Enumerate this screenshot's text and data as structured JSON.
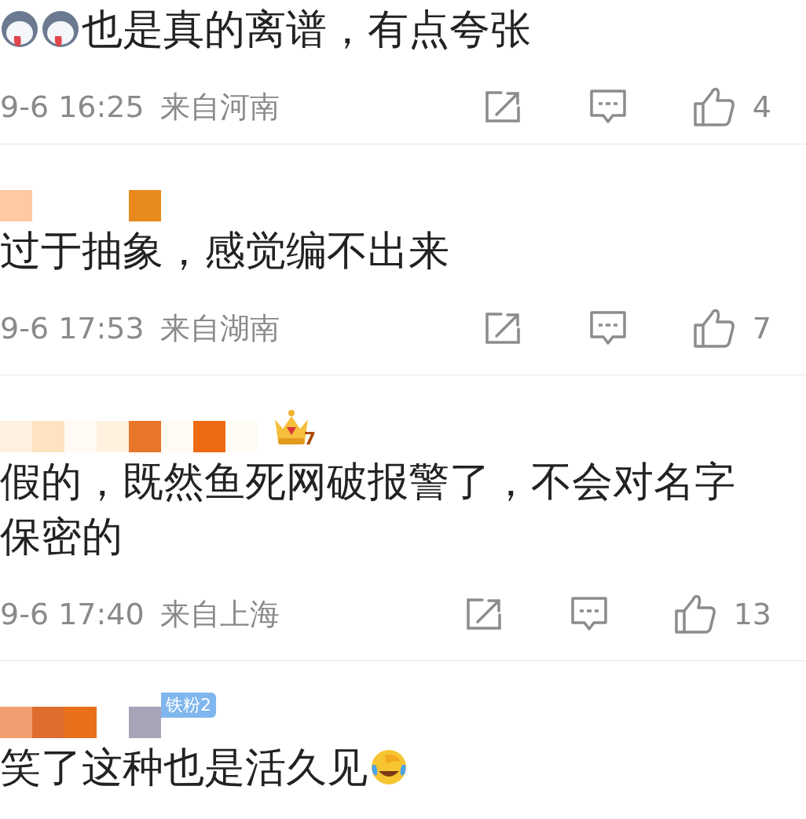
{
  "comments": [
    {
      "segments": [
        {
          "kind": "husky"
        },
        {
          "kind": "husky"
        },
        {
          "kind": "text",
          "text": "也是真的离谱，有点夸张"
        }
      ],
      "meta": {
        "time": "9-6 16:25",
        "location": "来自河南",
        "likes": "4"
      }
    },
    {
      "user": {
        "kind": "picture"
      },
      "segments": [
        {
          "kind": "text",
          "text": "过于抽象，感觉编不出来"
        }
      ],
      "meta": {
        "time": "9-6 17:53",
        "location": "来自湖南",
        "likes": "7"
      }
    },
    {
      "user": {
        "kind": "picture",
        "badge": {
          "kind": "crown",
          "label": "7"
        }
      },
      "segments": [
        {
          "kind": "text",
          "text": "假的，既然鱼死网破报警了，不会对名字保密的"
        }
      ],
      "meta": {
        "time": "9-6 17:40",
        "location": "来自上海",
        "likes": "13"
      }
    },
    {
      "user": {
        "kind": "picture",
        "badge": {
          "kind": "fan",
          "label": "铁粉2"
        }
      },
      "segments": [
        {
          "kind": "text",
          "text": "笑了这种也是活久见"
        },
        {
          "kind": "laugh-cry"
        }
      ]
    }
  ]
}
